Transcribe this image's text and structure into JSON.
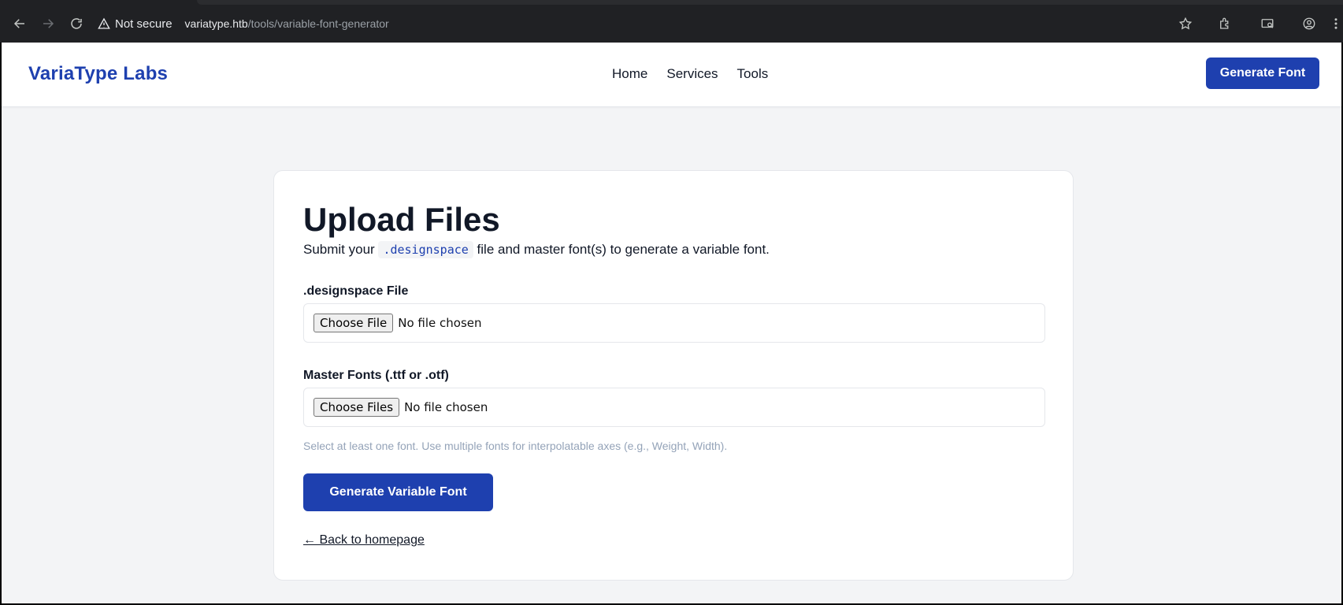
{
  "browser": {
    "security_label": "Not secure",
    "url_host": "variatype.htb",
    "url_path": "/tools/variable-font-generator"
  },
  "header": {
    "logo": "VariaType Labs",
    "nav": [
      "Home",
      "Services",
      "Tools"
    ],
    "cta": "Generate Font"
  },
  "form": {
    "title": "Upload Files",
    "subtitle_before": "Submit your ",
    "subtitle_code": ".designspace",
    "subtitle_after": " file and master font(s) to generate a variable font.",
    "designspace_label": ".designspace File",
    "designspace_button": "Choose File",
    "designspace_status": "No file chosen",
    "masters_label": "Master Fonts (.ttf or .otf)",
    "masters_button": "Choose Files",
    "masters_status": "No file chosen",
    "hint": "Select at least one font. Use multiple fonts for interpolatable axes (e.g., Weight, Width).",
    "submit": "Generate Variable Font",
    "back_link": "← Back to homepage"
  },
  "colors": {
    "brand": "#1e40af",
    "page_bg": "#f3f4f6",
    "chrome_bg": "#202124"
  }
}
